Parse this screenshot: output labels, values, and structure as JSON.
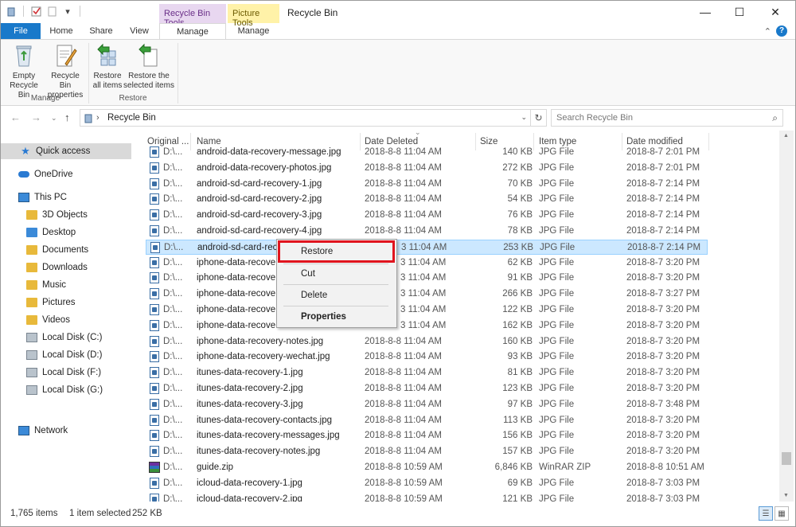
{
  "window": {
    "title": "Recycle Bin",
    "context_tabs": [
      "Recycle Bin Tools",
      "Picture Tools"
    ],
    "controls": {
      "minimize": "—",
      "maximize": "☐",
      "close": "✕"
    }
  },
  "ribbon_tabs": [
    "File",
    "Home",
    "Share",
    "View",
    "Manage",
    "Manage"
  ],
  "ribbon": {
    "manage_group": {
      "label": "Manage",
      "empty": [
        "Empty",
        "Recycle Bin"
      ],
      "properties": [
        "Recycle Bin",
        "properties"
      ]
    },
    "restore_group": {
      "label": "Restore",
      "restore_all": [
        "Restore",
        "all items"
      ],
      "restore_selected": [
        "Restore the",
        "selected items"
      ]
    }
  },
  "address": {
    "path": "Recycle Bin",
    "search_placeholder": "Search Recycle Bin"
  },
  "nav": {
    "quick_access": "Quick access",
    "onedrive": "OneDrive",
    "this_pc": "This PC",
    "items": [
      "3D Objects",
      "Desktop",
      "Documents",
      "Downloads",
      "Music",
      "Pictures",
      "Videos"
    ],
    "disks": [
      "Local Disk (C:)",
      "Local Disk (D:)",
      "Local Disk (F:)",
      "Local Disk (G:)"
    ],
    "network": "Network"
  },
  "columns": [
    "Original ...",
    "Name",
    "Date Deleted",
    "Size",
    "Item type",
    "Date modified"
  ],
  "files": [
    {
      "orig": "D:\\...",
      "name": "android-data-recovery-message.jpg",
      "deleted": "2018-8-8 11:04 AM",
      "size": "140 KB",
      "type": "JPG File",
      "modified": "2018-8-7 2:01 PM"
    },
    {
      "orig": "D:\\...",
      "name": "android-data-recovery-photos.jpg",
      "deleted": "2018-8-8 11:04 AM",
      "size": "272 KB",
      "type": "JPG File",
      "modified": "2018-8-7 2:01 PM"
    },
    {
      "orig": "D:\\...",
      "name": "android-sd-card-recovery-1.jpg",
      "deleted": "2018-8-8 11:04 AM",
      "size": "70 KB",
      "type": "JPG File",
      "modified": "2018-8-7 2:14 PM"
    },
    {
      "orig": "D:\\...",
      "name": "android-sd-card-recovery-2.jpg",
      "deleted": "2018-8-8 11:04 AM",
      "size": "54 KB",
      "type": "JPG File",
      "modified": "2018-8-7 2:14 PM"
    },
    {
      "orig": "D:\\...",
      "name": "android-sd-card-recovery-3.jpg",
      "deleted": "2018-8-8 11:04 AM",
      "size": "76 KB",
      "type": "JPG File",
      "modified": "2018-8-7 2:14 PM"
    },
    {
      "orig": "D:\\...",
      "name": "android-sd-card-recovery-4.jpg",
      "deleted": "2018-8-8 11:04 AM",
      "size": "78 KB",
      "type": "JPG File",
      "modified": "2018-8-7 2:14 PM"
    },
    {
      "orig": "D:\\...",
      "name": "android-sd-card-rec",
      "deleted": "3 11:04 AM",
      "size": "253 KB",
      "type": "JPG File",
      "modified": "2018-8-7 2:14 PM"
    },
    {
      "orig": "D:\\...",
      "name": "iphone-data-recove",
      "deleted": "3 11:04 AM",
      "size": "62 KB",
      "type": "JPG File",
      "modified": "2018-8-7 3:20 PM"
    },
    {
      "orig": "D:\\...",
      "name": "iphone-data-recove",
      "deleted": "3 11:04 AM",
      "size": "91 KB",
      "type": "JPG File",
      "modified": "2018-8-7 3:20 PM"
    },
    {
      "orig": "D:\\...",
      "name": "iphone-data-recove",
      "deleted": "3 11:04 AM",
      "size": "266 KB",
      "type": "JPG File",
      "modified": "2018-8-7 3:27 PM"
    },
    {
      "orig": "D:\\...",
      "name": "iphone-data-recove",
      "deleted": "3 11:04 AM",
      "size": "122 KB",
      "type": "JPG File",
      "modified": "2018-8-7 3:20 PM"
    },
    {
      "orig": "D:\\...",
      "name": "iphone-data-recove",
      "deleted": "3 11:04 AM",
      "size": "162 KB",
      "type": "JPG File",
      "modified": "2018-8-7 3:20 PM"
    },
    {
      "orig": "D:\\...",
      "name": "iphone-data-recovery-notes.jpg",
      "deleted": "2018-8-8 11:04 AM",
      "size": "160 KB",
      "type": "JPG File",
      "modified": "2018-8-7 3:20 PM"
    },
    {
      "orig": "D:\\...",
      "name": "iphone-data-recovery-wechat.jpg",
      "deleted": "2018-8-8 11:04 AM",
      "size": "93 KB",
      "type": "JPG File",
      "modified": "2018-8-7 3:20 PM"
    },
    {
      "orig": "D:\\...",
      "name": "itunes-data-recovery-1.jpg",
      "deleted": "2018-8-8 11:04 AM",
      "size": "81 KB",
      "type": "JPG File",
      "modified": "2018-8-7 3:20 PM"
    },
    {
      "orig": "D:\\...",
      "name": "itunes-data-recovery-2.jpg",
      "deleted": "2018-8-8 11:04 AM",
      "size": "123 KB",
      "type": "JPG File",
      "modified": "2018-8-7 3:20 PM"
    },
    {
      "orig": "D:\\...",
      "name": "itunes-data-recovery-3.jpg",
      "deleted": "2018-8-8 11:04 AM",
      "size": "97 KB",
      "type": "JPG File",
      "modified": "2018-8-7 3:48 PM"
    },
    {
      "orig": "D:\\...",
      "name": "itunes-data-recovery-contacts.jpg",
      "deleted": "2018-8-8 11:04 AM",
      "size": "113 KB",
      "type": "JPG File",
      "modified": "2018-8-7 3:20 PM"
    },
    {
      "orig": "D:\\...",
      "name": "itunes-data-recovery-messages.jpg",
      "deleted": "2018-8-8 11:04 AM",
      "size": "156 KB",
      "type": "JPG File",
      "modified": "2018-8-7 3:20 PM"
    },
    {
      "orig": "D:\\...",
      "name": "itunes-data-recovery-notes.jpg",
      "deleted": "2018-8-8 11:04 AM",
      "size": "157 KB",
      "type": "JPG File",
      "modified": "2018-8-7 3:20 PM"
    },
    {
      "orig": "D:\\...",
      "name": "guide.zip",
      "deleted": "2018-8-8 10:59 AM",
      "size": "6,846 KB",
      "type": "WinRAR ZIP",
      "modified": "2018-8-8 10:51 AM"
    },
    {
      "orig": "D:\\...",
      "name": "icloud-data-recovery-1.jpg",
      "deleted": "2018-8-8 10:59 AM",
      "size": "69 KB",
      "type": "JPG File",
      "modified": "2018-8-7 3:03 PM"
    },
    {
      "orig": "D:\\...",
      "name": "icloud-data-recovery-2.jpg",
      "deleted": "2018-8-8 10:59 AM",
      "size": "121 KB",
      "type": "JPG File",
      "modified": "2018-8-7 3:03 PM"
    }
  ],
  "context_menu": {
    "restore": "Restore",
    "cut": "Cut",
    "delete": "Delete",
    "properties": "Properties"
  },
  "status": {
    "count": "1,765 items",
    "selected": "1 item selected",
    "size": "252 KB"
  },
  "colors": {
    "accent": "#1979ca",
    "highlight": "#e0141e",
    "selection": "#cce8ff"
  }
}
